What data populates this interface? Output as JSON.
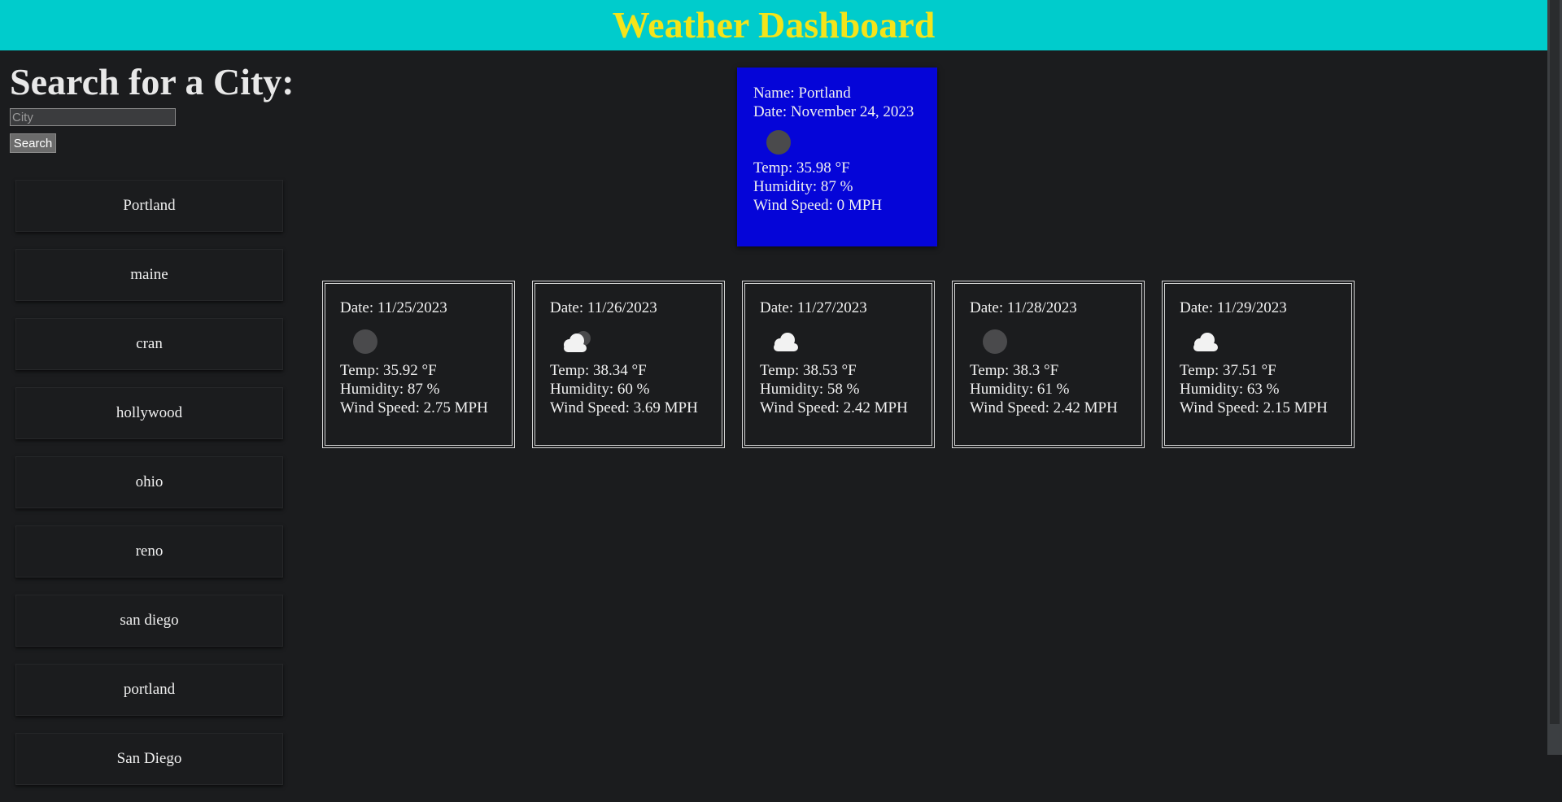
{
  "header": {
    "title": "Weather Dashboard"
  },
  "search": {
    "title": "Search for a City:",
    "placeholder": "City",
    "button_label": "Search"
  },
  "history": [
    "Portland",
    "maine",
    "cran",
    "hollywood",
    "ohio",
    "reno",
    "san diego",
    "portland",
    "San Diego"
  ],
  "current": {
    "name": "Name: Portland",
    "date": "Date: November 24, 2023",
    "icon": "moon-icon",
    "temp": "Temp: 35.98 °F",
    "humidity": "Humidity: 87 %",
    "wind": "Wind Speed: 0 MPH"
  },
  "forecast": [
    {
      "date": "Date: 11/25/2023",
      "icon": "moon-icon",
      "temp": "Temp: 35.92 °F",
      "humidity": "Humidity: 87 %",
      "wind": "Wind Speed: 2.75 MPH"
    },
    {
      "date": "Date: 11/26/2023",
      "icon": "cloud-moon-icon",
      "temp": "Temp: 38.34 °F",
      "humidity": "Humidity: 60 %",
      "wind": "Wind Speed: 3.69 MPH"
    },
    {
      "date": "Date: 11/27/2023",
      "icon": "cloud-icon",
      "temp": "Temp: 38.53 °F",
      "humidity": "Humidity: 58 %",
      "wind": "Wind Speed: 2.42 MPH"
    },
    {
      "date": "Date: 11/28/2023",
      "icon": "moon-icon",
      "temp": "Temp: 38.3 °F",
      "humidity": "Humidity: 61 %",
      "wind": "Wind Speed: 2.42 MPH"
    },
    {
      "date": "Date: 11/29/2023",
      "icon": "cloud-icon",
      "temp": "Temp: 37.51 °F",
      "humidity": "Humidity: 63 %",
      "wind": "Wind Speed: 2.15 MPH"
    }
  ],
  "colors": {
    "header_bg": "#00cccc",
    "header_text": "#f4e41a",
    "current_card_bg": "#0505d8",
    "page_bg": "#1b1c1e"
  }
}
